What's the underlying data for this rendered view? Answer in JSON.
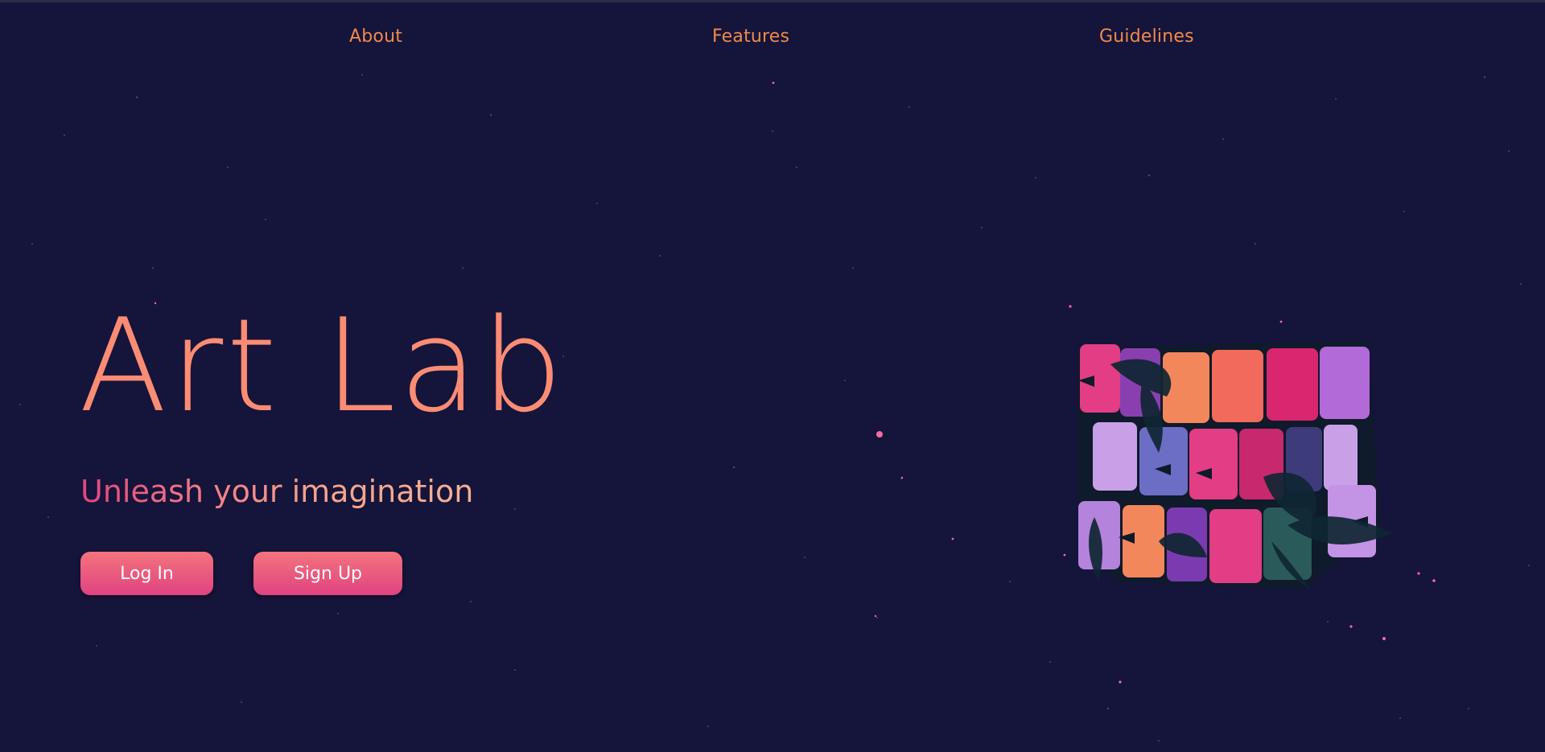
{
  "nav": {
    "about": "About",
    "features": "Features",
    "guidelines": "Guidelines"
  },
  "hero": {
    "title": "Art Lab",
    "subtitle": "Unleash your imagination"
  },
  "buttons": {
    "login": "Log In",
    "signup": "Sign Up"
  },
  "illustration": {
    "icon": "rubiks-cube-illustration"
  },
  "colors": {
    "background": "#15143a",
    "nav_link": "#f08a4b",
    "title": "#fb8c74",
    "button_top": "#f3747d",
    "button_bottom": "#e04380"
  }
}
